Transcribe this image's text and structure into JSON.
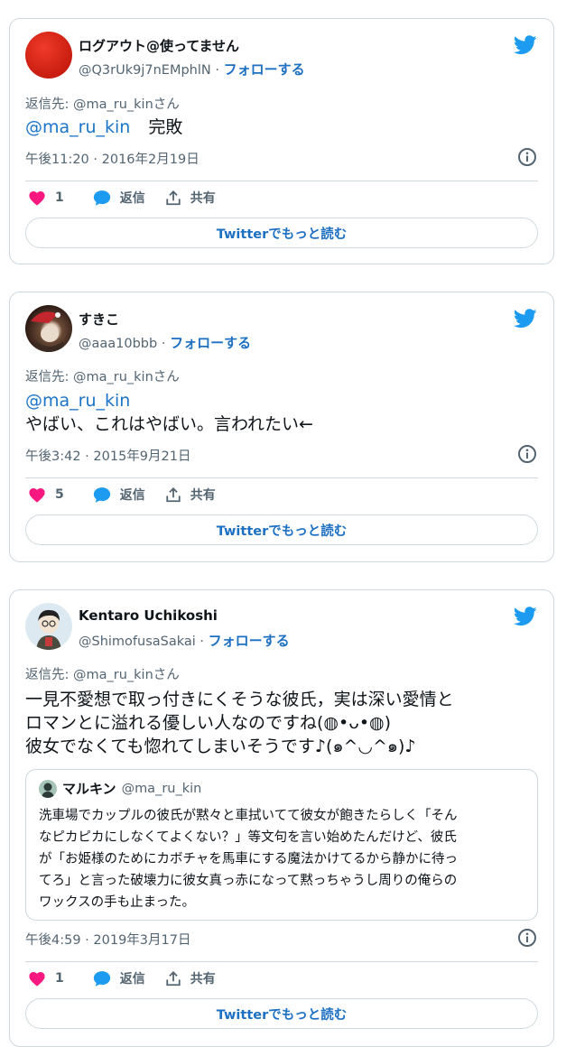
{
  "tweets": [
    {
      "name": "ログアウト@使ってません",
      "handle": "@Q3rUk9j7nEMphlN",
      "separator": "·",
      "follow": "フォローする",
      "reply_to": "返信先: @ma_ru_kinさん",
      "mention": "@ma_ru_kin",
      "text": "完敗",
      "date": "午後11:20 · 2016年2月19日",
      "likes": "1",
      "reply_label": "返信",
      "share_label": "共有",
      "more_label": "Twitterでもっと読む"
    },
    {
      "name": "すきこ",
      "handle": "@aaa10bbb",
      "separator": "·",
      "follow": "フォローする",
      "reply_to": "返信先: @ma_ru_kinさん",
      "mention": "@ma_ru_kin",
      "text": "やばい、これはやばい。言われたい←",
      "date": "午後3:42 · 2015年9月21日",
      "likes": "5",
      "reply_label": "返信",
      "share_label": "共有",
      "more_label": "Twitterでもっと読む"
    },
    {
      "name": "Kentaro Uchikoshi",
      "handle": "@ShimofusaSakai",
      "separator": "·",
      "follow": "フォローする",
      "reply_to": "返信先: @ma_ru_kinさん",
      "text_lines": [
        "一見不愛想で取っ付きにくそうな彼氏，実は深い愛情と",
        "ロマンとに溢れる優しい人なのですね(◍•ᴗ•◍)",
        "彼女でなくても惚れてしまいそうです♪(๑^◡^๑)♪"
      ],
      "quote": {
        "name": "マルキン",
        "handle": "@ma_ru_kin",
        "text": "洗車場でカップルの彼氏が黙々と車拭いてて彼女が飽きたらしく「そん\nなピカピカにしなくてよくない？」等文句を言い始めたんだけど、彼氏\nが「お姫様のためにカボチャを馬車にする魔法かけてるから静かに待っ\nてろ」と言った破壊力に彼女真っ赤になって黙っちゃうし周りの俺らの\nワックスの手も止まった。"
      },
      "date": "午後4:59 · 2019年3月17日",
      "likes": "1",
      "reply_label": "返信",
      "share_label": "共有",
      "more_label": "Twitterでもっと読む"
    }
  ],
  "colors": {
    "link": "#1d6fc2",
    "heart": "#f91880",
    "bird": "#1d9bf0",
    "muted": "#536471",
    "border": "#cfd9de"
  },
  "icons": [
    "twitter-bird-icon",
    "heart-icon",
    "reply-bubble-icon",
    "share-icon",
    "info-icon"
  ]
}
